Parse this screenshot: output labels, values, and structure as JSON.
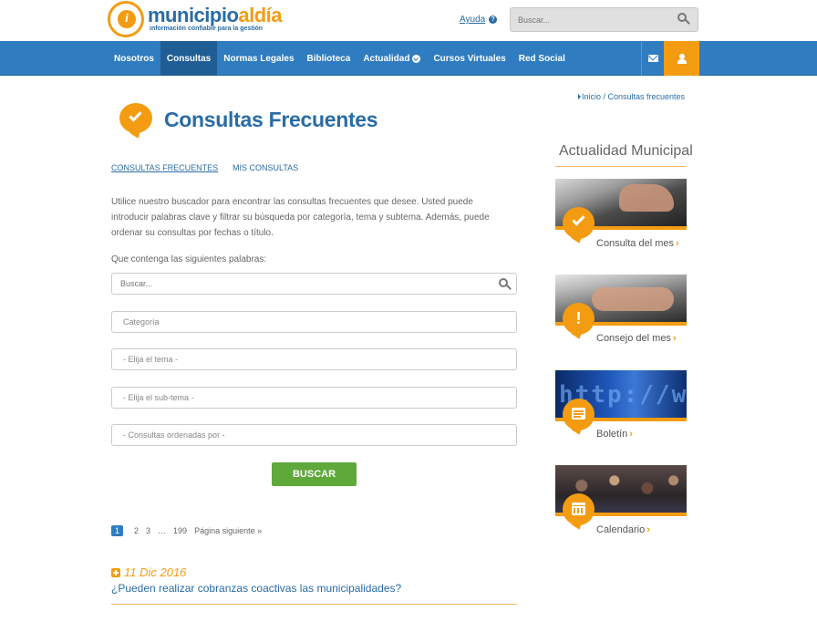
{
  "header": {
    "logo_word_1": "municipio",
    "logo_word_2": "aldía",
    "logo_tagline": "información confiable para la gestión",
    "help_label": "Ayuda",
    "search_placeholder": "Buscar..."
  },
  "nav": {
    "items": [
      {
        "label": "Nosotros"
      },
      {
        "label": "Consultas"
      },
      {
        "label": "Normas Legales"
      },
      {
        "label": "Biblioteca"
      },
      {
        "label": "Actualidad"
      },
      {
        "label": "Cursos Virtuales"
      },
      {
        "label": "Red Social"
      }
    ],
    "active_index": 1
  },
  "breadcrumb": "Inicio / Consultas frecuentes",
  "page": {
    "title": "Consultas Frecuentes",
    "tabs": [
      {
        "label": "CONSULTAS FRECUENTES"
      },
      {
        "label": "MIS CONSULTAS"
      }
    ],
    "intro": "Utilice nuestro buscador para encontrar las consultas frecuentes que desee. Usted puede introducir palabras clave y filtrar su búsqueda por categoría, tema y subtema. Además, puede ordenar su consultas por fechas o título.",
    "words_label": "Que contenga las siguientes palabras:",
    "search_placeholder": "Buscar...",
    "selects": {
      "category": "Categoría",
      "theme": "- Elija el tema -",
      "subtheme": "- Elija el sub-tema -",
      "order": "- Consultas ordenadas por -"
    },
    "submit_label": "BUSCAR",
    "pagination": {
      "pages": [
        "1",
        "2",
        "3",
        "…",
        "199"
      ],
      "next_label": "Página siguiente »"
    },
    "result": {
      "date": "11 Dic 2016",
      "question": "¿Pueden realizar cobranzas coactivas las municipalidades?"
    }
  },
  "sidebar": {
    "title": "Actualidad Municipal",
    "cards": [
      {
        "label": "Consulta del mes",
        "icon": "check-icon"
      },
      {
        "label": "Consejo del mes",
        "icon": "exclamation-icon"
      },
      {
        "label": "Boletín",
        "icon": "newspaper-icon"
      },
      {
        "label": "Calendario",
        "icon": "calendar-icon"
      }
    ]
  },
  "colors": {
    "brand_blue": "#2f7cc0",
    "brand_orange": "#f39c12",
    "button_green": "#5fa83a"
  }
}
